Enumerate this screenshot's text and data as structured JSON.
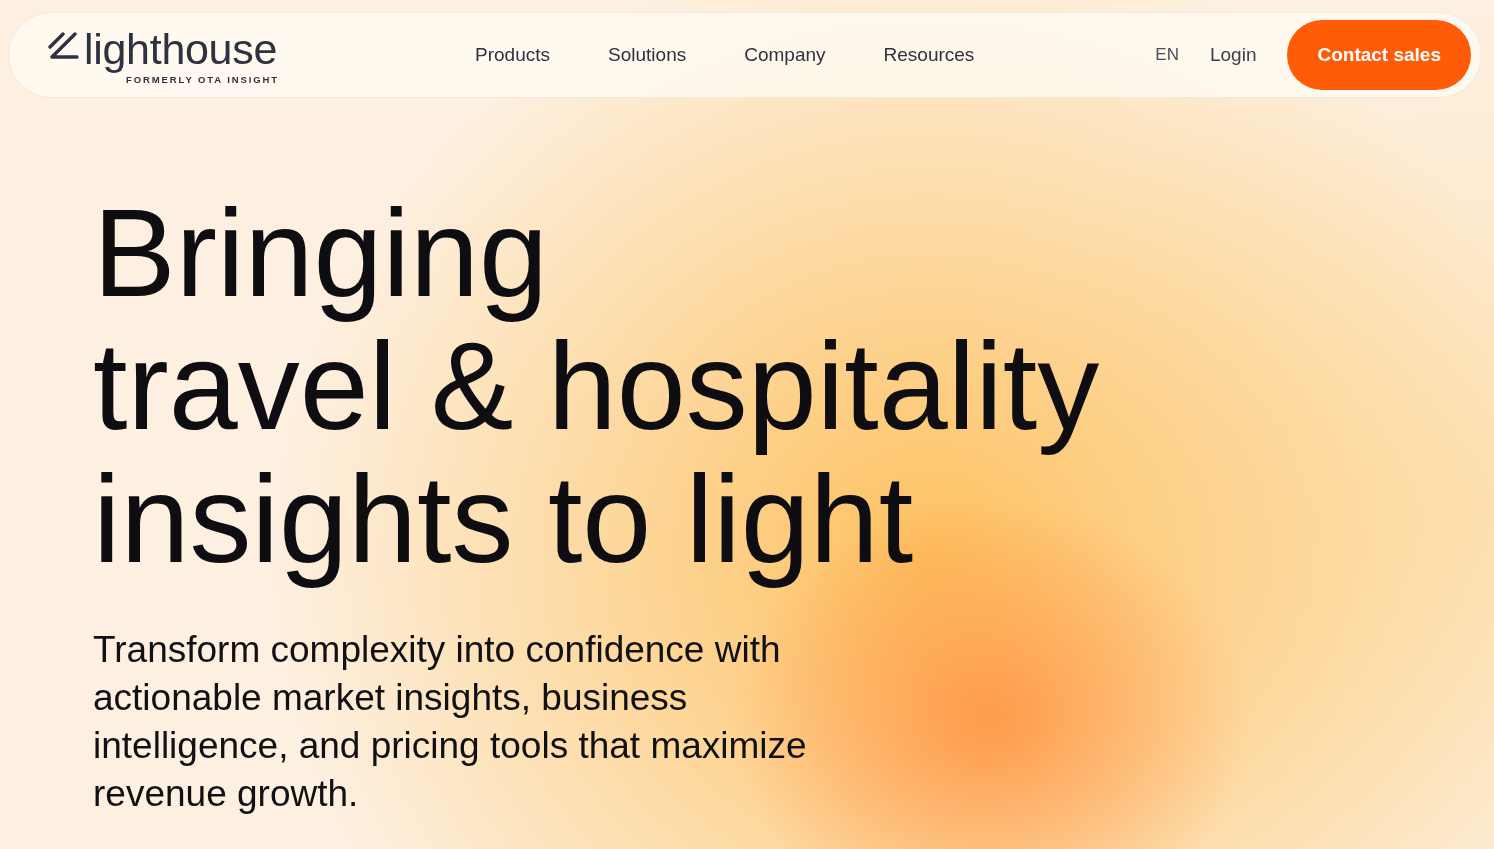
{
  "nav": {
    "logo": {
      "wordmark": "lighthouse",
      "tagline": "FORMERLY OTA INSIGHT"
    },
    "links": [
      "Products",
      "Solutions",
      "Company",
      "Resources"
    ],
    "language": "EN",
    "login": "Login",
    "cta": "Contact sales"
  },
  "hero": {
    "headline_lines": [
      "Bringing",
      "travel & hospitality",
      "insights to light"
    ],
    "subheading": "Transform complexity into confidence with actionable market insights, business intelligence, and pricing tools that maximize revenue growth."
  }
}
